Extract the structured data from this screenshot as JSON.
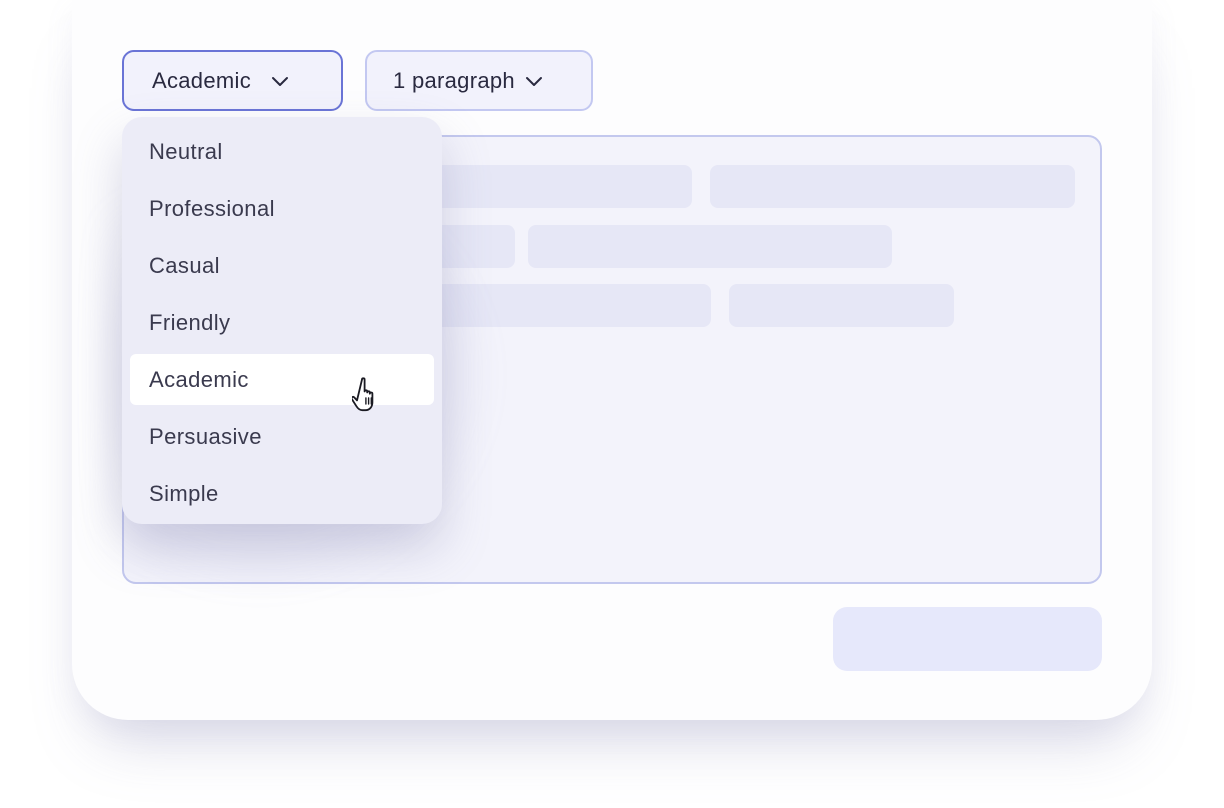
{
  "toolbar": {
    "tone_select": {
      "value": "Academic",
      "icon": "chevron-down-icon"
    },
    "length_select": {
      "value": "1 paragraph",
      "icon": "chevron-down-icon"
    }
  },
  "tone_menu": {
    "items": [
      {
        "label": "Neutral"
      },
      {
        "label": "Professional"
      },
      {
        "label": "Casual"
      },
      {
        "label": "Friendly"
      },
      {
        "label": "Academic",
        "selected": true
      },
      {
        "label": "Persuasive"
      },
      {
        "label": "Simple"
      }
    ],
    "pointer_icon": "hand-pointer-icon"
  },
  "colors": {
    "accent": "#6a74d6",
    "border_light": "#c3c8ee",
    "panel": "#ececf7",
    "placeholder": "#e6e7f6"
  }
}
